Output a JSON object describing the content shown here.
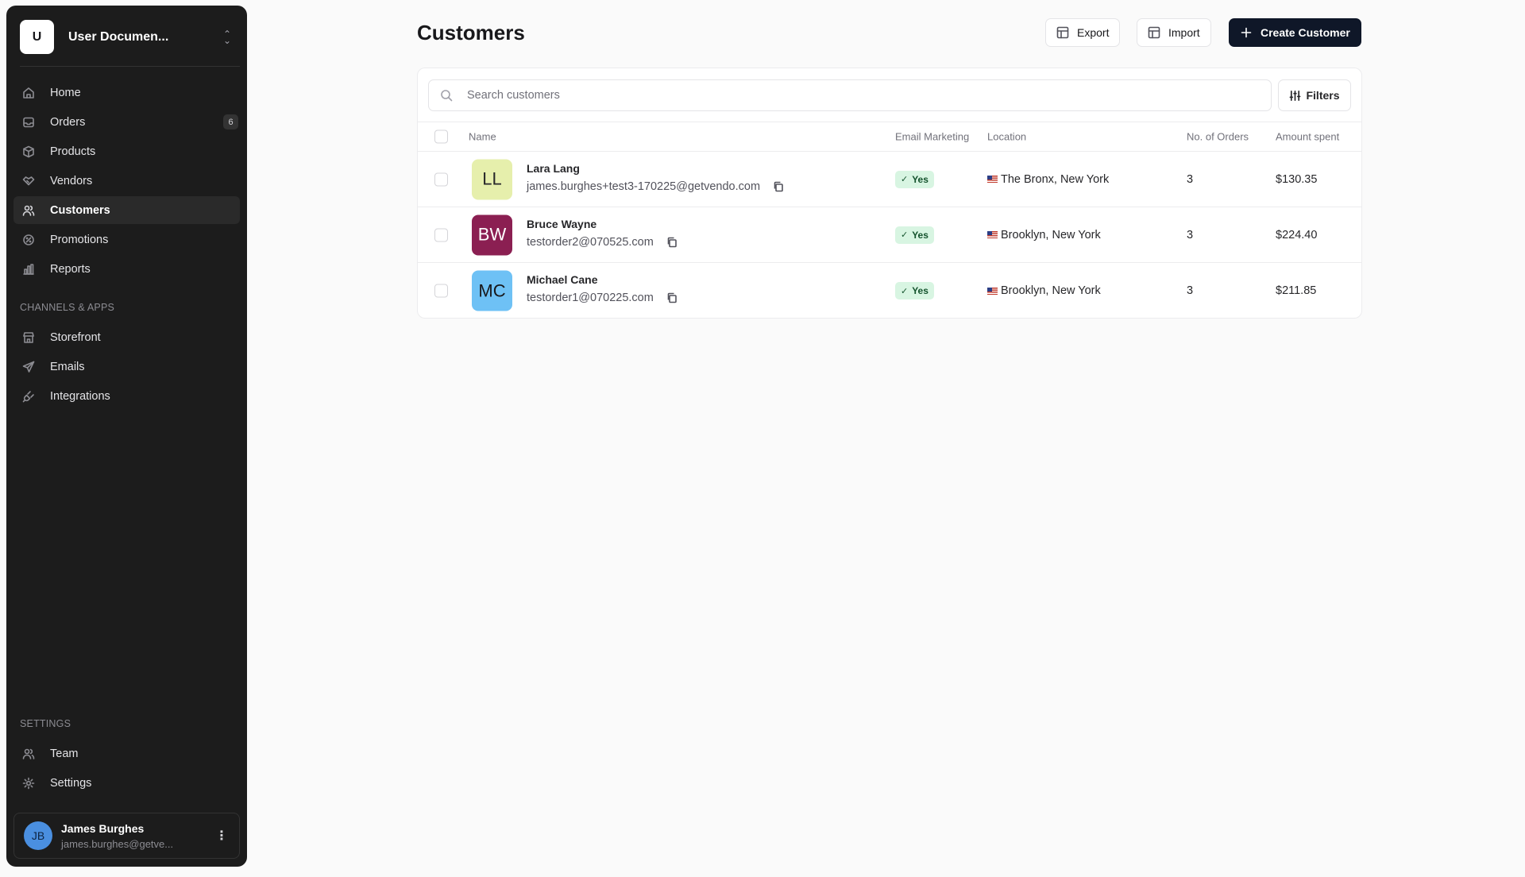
{
  "workspace": {
    "badge": "U",
    "name": "User Documen..."
  },
  "nav": [
    {
      "label": "Home",
      "icon": "home-icon"
    },
    {
      "label": "Orders",
      "icon": "inbox-icon",
      "count": "6"
    },
    {
      "label": "Products",
      "icon": "package-icon"
    },
    {
      "label": "Vendors",
      "icon": "handshake-icon"
    },
    {
      "label": "Customers",
      "icon": "users-icon",
      "active": true
    },
    {
      "label": "Promotions",
      "icon": "percent-badge-icon"
    },
    {
      "label": "Reports",
      "icon": "bar-chart-icon"
    }
  ],
  "channels": {
    "title": "CHANNELS & APPS",
    "items": [
      {
        "label": "Storefront",
        "icon": "store-icon"
      },
      {
        "label": "Emails",
        "icon": "send-icon"
      },
      {
        "label": "Integrations",
        "icon": "plug-icon"
      }
    ]
  },
  "settings": {
    "title": "SETTINGS",
    "items": [
      {
        "label": "Team",
        "icon": "users-icon"
      },
      {
        "label": "Settings",
        "icon": "gear-icon"
      }
    ]
  },
  "user": {
    "initials": "JB",
    "name": "James Burghes",
    "email": "james.burghes@getve..."
  },
  "page": {
    "title": "Customers",
    "export_label": "Export",
    "import_label": "Import",
    "create_label": "Create Customer"
  },
  "search": {
    "placeholder": "Search customers",
    "filters_label": "Filters"
  },
  "table": {
    "columns": [
      "Name",
      "Email Marketing",
      "Location",
      "No. of Orders",
      "Amount spent"
    ],
    "rows": [
      {
        "initials": "LL",
        "avatar_bg": "#e6efac",
        "avatar_fg": "#27272a",
        "name": "Lara Lang",
        "email": "james.burghes+test3-170225@getvendo.com",
        "marketing": "Yes",
        "location": "The Bronx, New York",
        "orders": "3",
        "amount": "$130.35"
      },
      {
        "initials": "BW",
        "avatar_bg": "#8b1f52",
        "avatar_fg": "#ffffff",
        "name": "Bruce Wayne",
        "email": "testorder2@070525.com",
        "marketing": "Yes",
        "location": "Brooklyn, New York",
        "orders": "3",
        "amount": "$224.40"
      },
      {
        "initials": "MC",
        "avatar_bg": "#6ec1f5",
        "avatar_fg": "#18181b",
        "name": "Michael Cane",
        "email": "testorder1@070225.com",
        "marketing": "Yes",
        "location": "Brooklyn, New York",
        "orders": "3",
        "amount": "$211.85"
      }
    ]
  }
}
